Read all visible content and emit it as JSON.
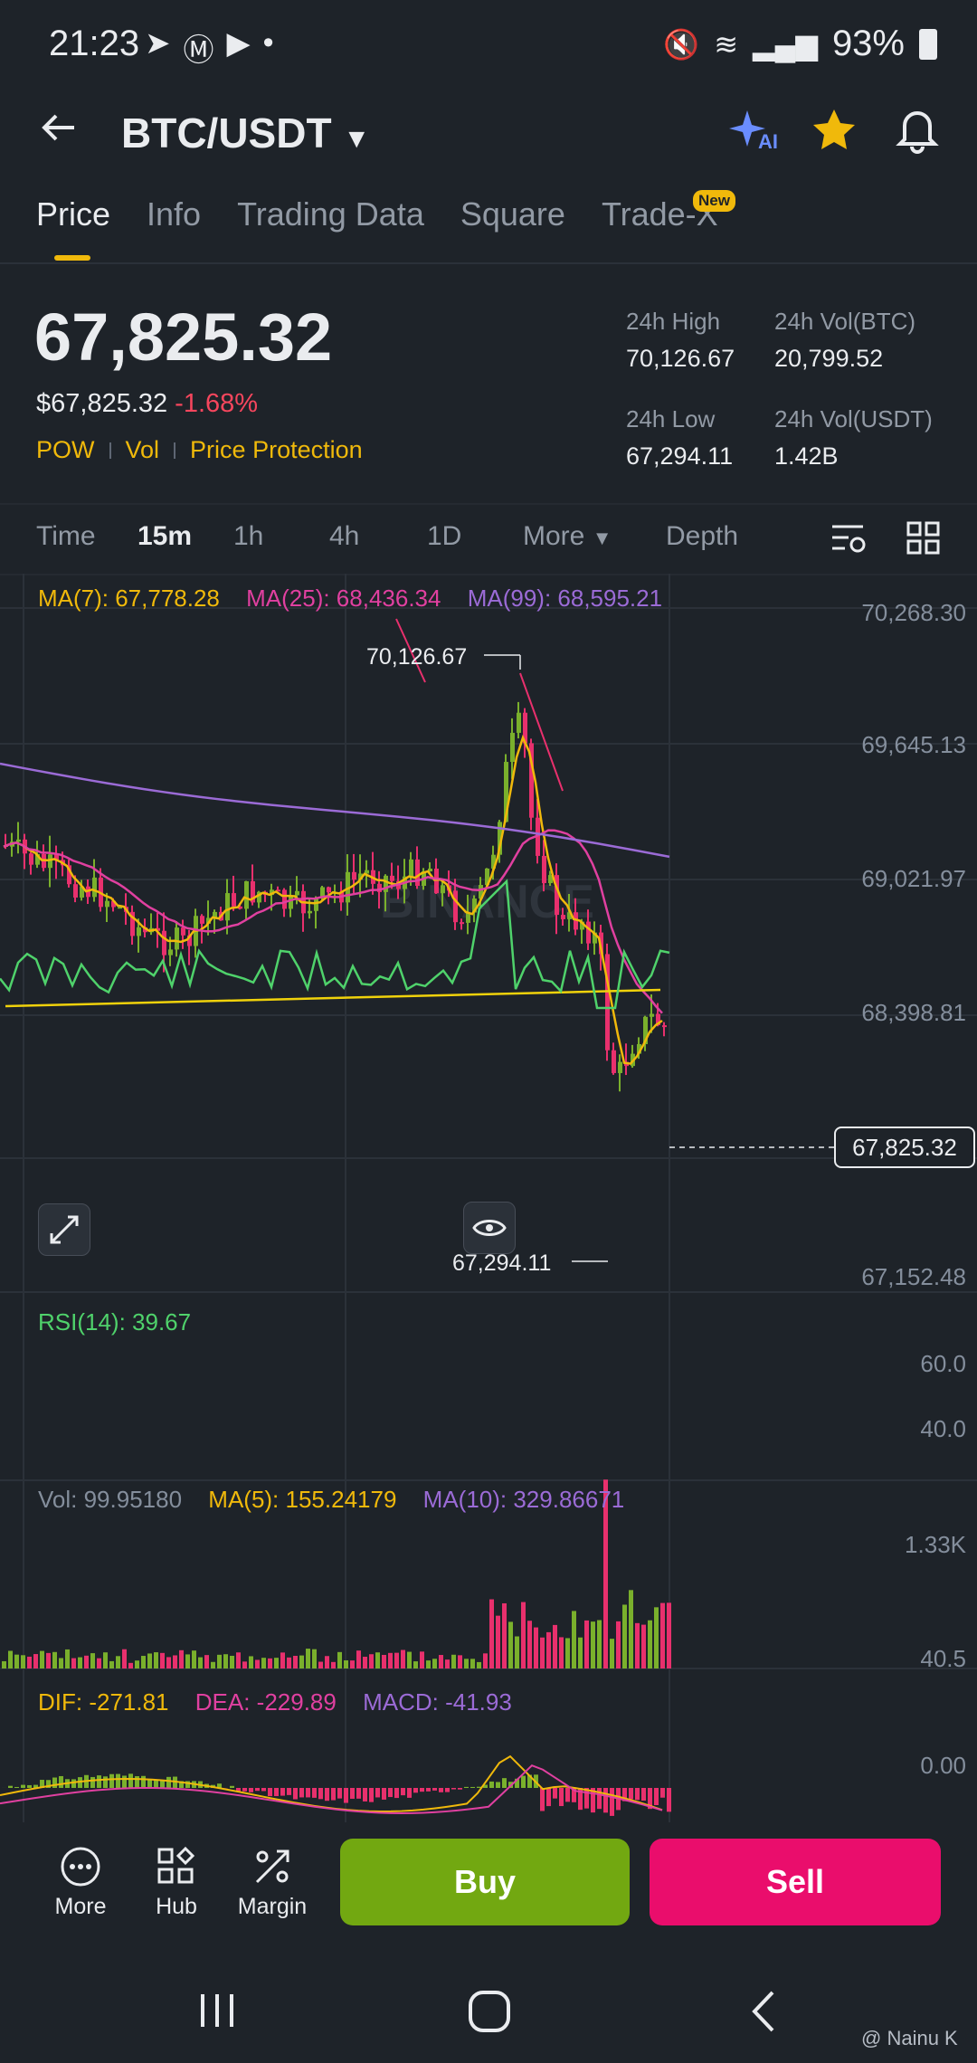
{
  "status_bar": {
    "time": "21:23",
    "battery": "93%"
  },
  "header": {
    "pair": "BTC/USDT",
    "ai_label": "AI"
  },
  "tabs": [
    {
      "label": "Price"
    },
    {
      "label": "Info"
    },
    {
      "label": "Trading Data"
    },
    {
      "label": "Square"
    },
    {
      "label": "Trade-X"
    }
  ],
  "new_badge": "New",
  "ticker": {
    "last_price": "67,825.32",
    "usd_price": "$67,825.32",
    "change": "-1.68%",
    "tags": [
      "POW",
      "Vol",
      "Price Protection"
    ],
    "high_label": "24h High",
    "high": "70,126.67",
    "vol_btc_label": "24h Vol(BTC)",
    "vol_btc": "20,799.52",
    "low_label": "24h Low",
    "low": "67,294.11",
    "vol_usdt_label": "24h Vol(USDT)",
    "vol_usdt": "1.42B"
  },
  "timeframes": [
    "Time",
    "15m",
    "1h",
    "4h",
    "1D",
    "More",
    "Depth"
  ],
  "active_timeframe": "15m",
  "chart": {
    "ma7": "MA(7): 67,778.28",
    "ma25": "MA(25): 68,436.34",
    "ma99": "MA(99): 68,595.21",
    "y_ticks": [
      "70,268.30",
      "69,645.13",
      "69,021.97",
      "68,398.81",
      "67,152.48"
    ],
    "high_mark": "70,126.67",
    "low_mark": "67,294.11",
    "current": "67,825.32",
    "watermark": "BINANCE",
    "rsi": "RSI(14): 39.67",
    "rsi_ticks": [
      "60.0",
      "40.0"
    ],
    "vol": "Vol: 99.95180",
    "vol_ma5": "MA(5): 155.24179",
    "vol_ma10": "MA(10): 329.86671",
    "vol_ticks": [
      "1.33K",
      "40.5"
    ],
    "dif": "DIF: -271.81",
    "dea": "DEA: -229.89",
    "macd": "MACD: -41.93",
    "macd_ticks": [
      "0.00"
    ],
    "colors": {
      "up": "#7ab02c",
      "down": "#e8306d",
      "ma7": "#f0b90b",
      "ma25": "#e040a0",
      "ma99": "#9b6bd6",
      "rsi": "#4fd26b"
    }
  },
  "bottom": {
    "more": "More",
    "hub": "Hub",
    "margin": "Margin",
    "buy": "Buy",
    "sell": "Sell"
  },
  "watermark_credit": "@ Nainu K"
}
